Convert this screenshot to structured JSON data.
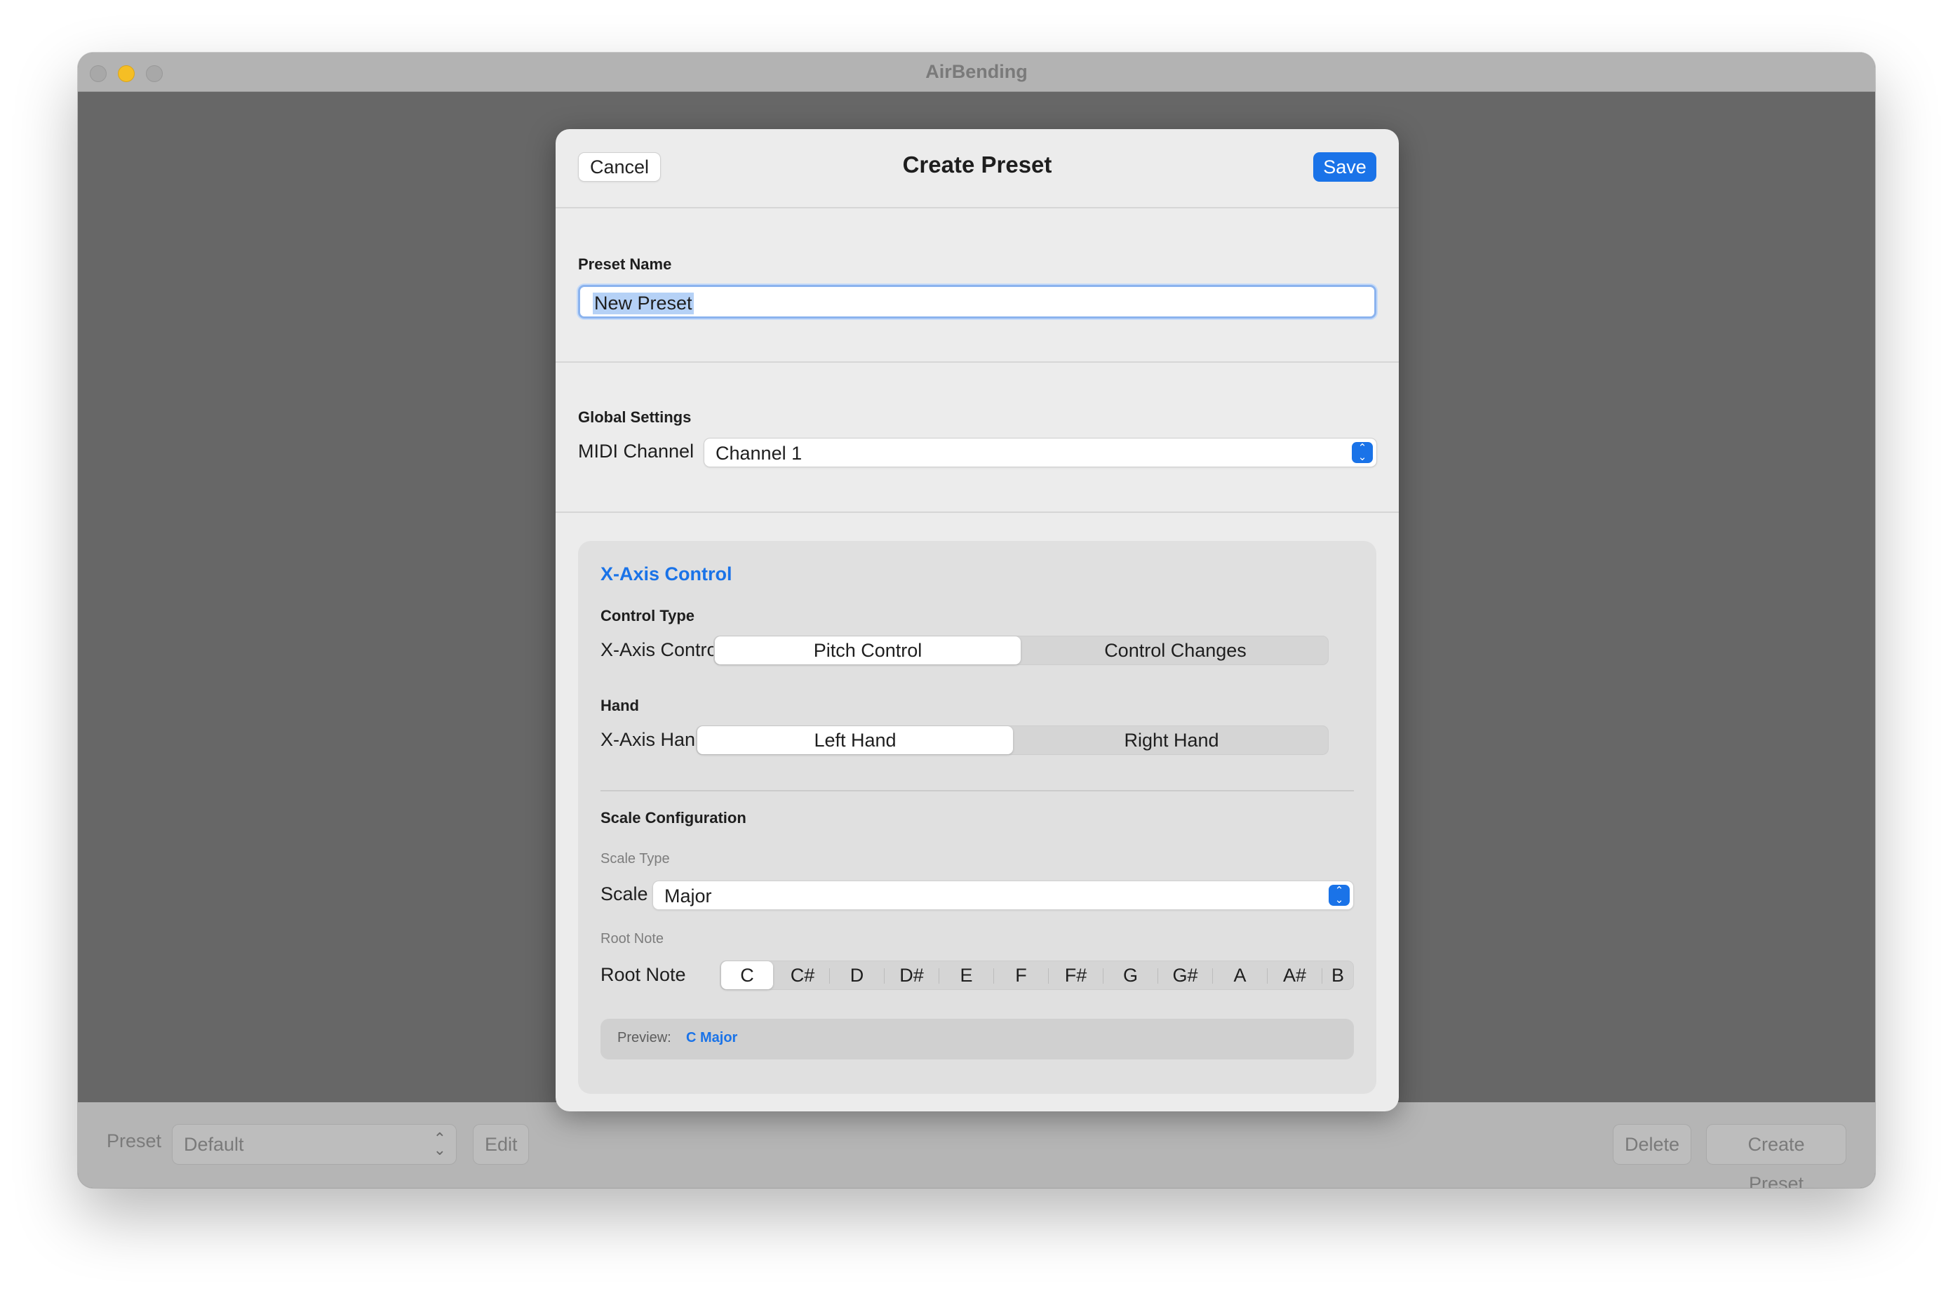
{
  "window": {
    "title": "AirBending"
  },
  "bottom_bar": {
    "preset_label": "Preset",
    "preset_value": "Default",
    "edit_label": "Edit",
    "delete_label": "Delete",
    "create_label": "Create Preset"
  },
  "sheet": {
    "title": "Create Preset",
    "cancel_label": "Cancel",
    "save_label": "Save",
    "preset_name": {
      "section_label": "Preset Name",
      "value": "New Preset"
    },
    "global": {
      "section_label": "Global Settings",
      "midi_label": "MIDI Channel",
      "midi_value": "Channel 1"
    },
    "x_axis": {
      "title": "X-Axis Control",
      "control_type_label": "Control Type",
      "control_row_label": "X-Axis Control",
      "control_options": [
        "Pitch Control",
        "Control Changes"
      ],
      "control_selected": "Pitch Control",
      "hand_label": "Hand",
      "hand_row_label": "X-Axis Hand",
      "hand_options": [
        "Left Hand",
        "Right Hand"
      ],
      "hand_selected": "Left Hand",
      "scale_config_label": "Scale Configuration",
      "scale_type_label": "Scale Type",
      "scale_row_label": "Scale",
      "scale_value": "Major",
      "root_note_caption": "Root Note",
      "root_row_label": "Root Note",
      "root_notes": [
        "C",
        "C#",
        "D",
        "D#",
        "E",
        "F",
        "F#",
        "G",
        "G#",
        "A",
        "A#",
        "B"
      ],
      "root_selected": "C",
      "preview_label": "Preview:",
      "preview_value": "C Major"
    }
  },
  "colors": {
    "accent": "#1a73e8",
    "sheet_bg": "#ececec",
    "backdrop": "#676767"
  }
}
